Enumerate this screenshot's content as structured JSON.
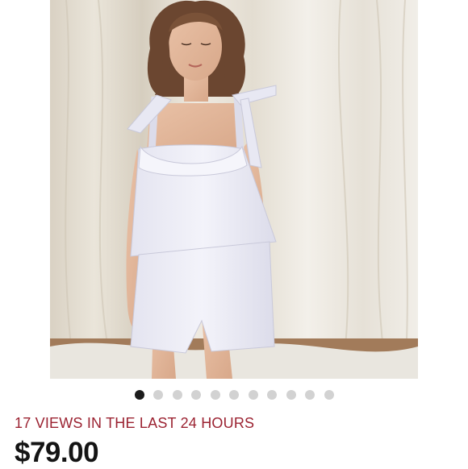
{
  "listing": {
    "image_description_icon": "product-photo",
    "carousel": {
      "count": 11,
      "active_index": 0
    },
    "views_text": "17 VIEWS IN THE LAST 24 HOURS",
    "price": "$79.00"
  },
  "colors": {
    "views": "#9b2231",
    "price": "#141414",
    "dot_active": "#1c1c1c",
    "dot_inactive": "#d2d2d2"
  }
}
